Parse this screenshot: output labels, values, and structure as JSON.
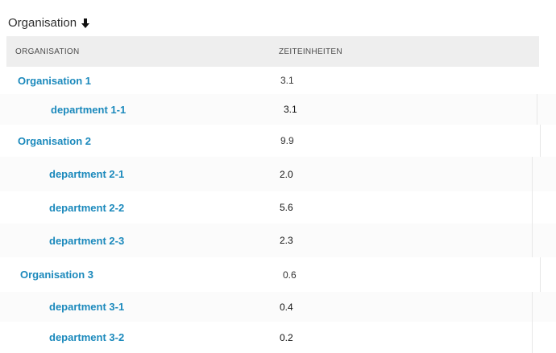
{
  "page": {
    "title": "Organisation",
    "sort_icon": "arrow-down-icon"
  },
  "table": {
    "columns": [
      {
        "label": "ORGANISATION"
      },
      {
        "label": "ZEITEINHEITEN"
      }
    ],
    "rows": [
      {
        "name": "Organisation 1",
        "value": "3.1",
        "type": "organisation"
      },
      {
        "name": "department  1-1",
        "value": "3.1",
        "type": "department"
      },
      {
        "name": "Organisation 2",
        "value": "9.9",
        "type": "organisation"
      },
      {
        "name": "department  2-1",
        "value": "2.0",
        "type": "department"
      },
      {
        "name": "department  2-2",
        "value": "5.6",
        "type": "department"
      },
      {
        "name": "department  2-3",
        "value": "2.3",
        "type": "department"
      },
      {
        "name": "Organisation 3",
        "value": "0.6",
        "type": "organisation"
      },
      {
        "name": "department  3-1",
        "value": "0.4",
        "type": "department"
      },
      {
        "name": "department  3-2",
        "value": "0.2",
        "type": "department"
      }
    ]
  },
  "colors": {
    "link": "#1b89bc",
    "header_background": "#eeeeee",
    "text": "#333333"
  }
}
